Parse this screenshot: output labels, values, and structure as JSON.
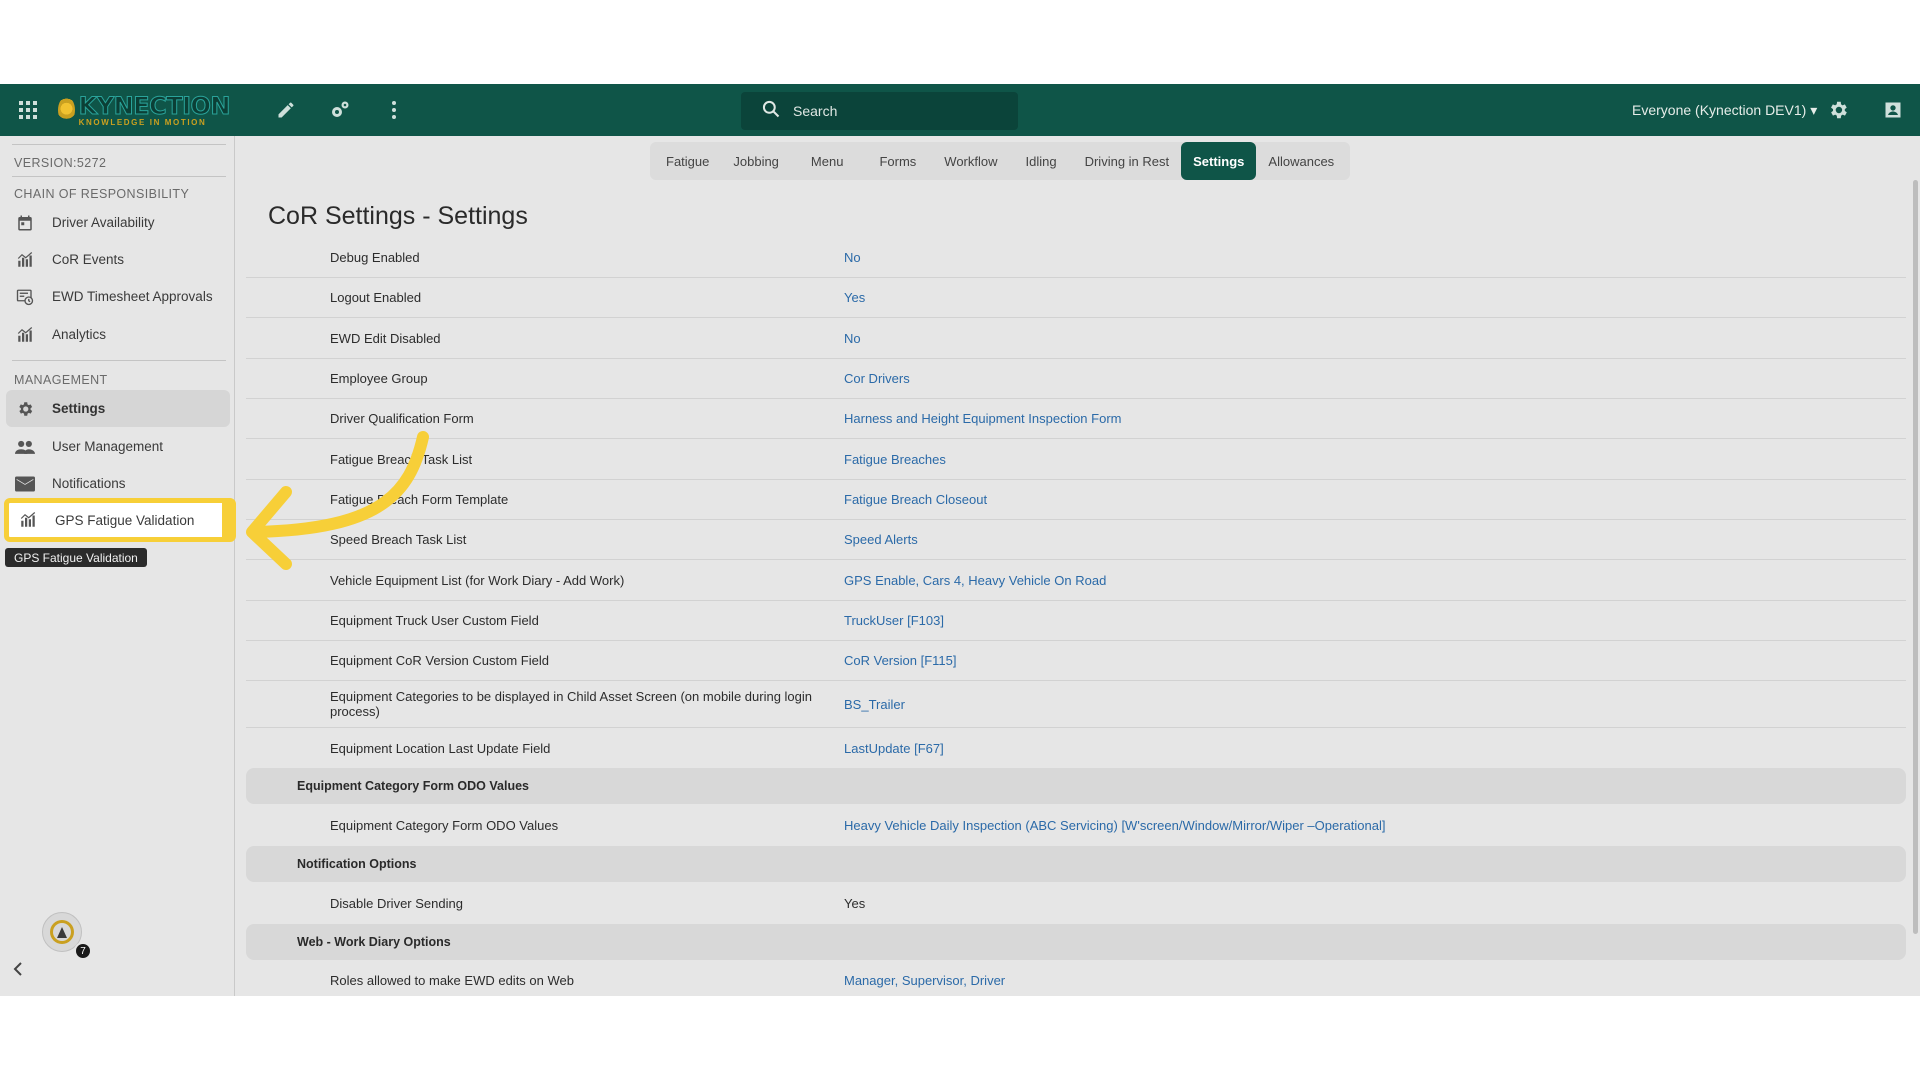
{
  "topbar": {
    "search_placeholder": "Search",
    "user_label": "Everyone (Kynection DEV1) ▾",
    "logo_title": "KYNECTION",
    "logo_tagline": "KNOWLEDGE IN MOTION"
  },
  "sidebar": {
    "version": "VERSION:5272",
    "sections": [
      {
        "heading": "CHAIN OF RESPONSIBILITY",
        "items": [
          {
            "label": "Driver Availability",
            "icon": "calendar-icon"
          },
          {
            "label": "CoR Events",
            "icon": "chart-icon"
          },
          {
            "label": "EWD Timesheet Approvals",
            "icon": "timesheet-icon"
          },
          {
            "label": "Analytics",
            "icon": "chart-icon"
          }
        ]
      },
      {
        "heading": "MANAGEMENT",
        "items": [
          {
            "label": "Settings",
            "icon": "gear-icon",
            "active": true
          },
          {
            "label": "User Management",
            "icon": "users-icon"
          },
          {
            "label": "Notifications",
            "icon": "mail-icon"
          },
          {
            "label": "GPS Fatigue Validation",
            "icon": "chart-icon",
            "highlighted": true
          }
        ]
      }
    ],
    "tooltip": "GPS Fatigue Validation",
    "avatar_badge": "7"
  },
  "tabs": [
    {
      "label": "Fatigue"
    },
    {
      "label": "Jobbing"
    },
    {
      "label": "Menu"
    },
    {
      "label": "Forms"
    },
    {
      "label": "Workflow"
    },
    {
      "label": "Idling"
    },
    {
      "label": "Driving in Rest"
    },
    {
      "label": "Settings",
      "active": true
    },
    {
      "label": "Allowances"
    }
  ],
  "page_title": "CoR Settings - Settings",
  "settings": [
    {
      "type": "row",
      "label": "Debug Enabled",
      "value": "No"
    },
    {
      "type": "row",
      "label": "Logout Enabled",
      "value": "Yes"
    },
    {
      "type": "row",
      "label": "EWD Edit Disabled",
      "value": "No"
    },
    {
      "type": "row",
      "label": "Employee Group",
      "value": "Cor Drivers"
    },
    {
      "type": "row",
      "label": "Driver Qualification Form",
      "value": "Harness and Height Equipment Inspection Form"
    },
    {
      "type": "row",
      "label": "Fatigue Breach Task List",
      "value": "Fatigue Breaches"
    },
    {
      "type": "row",
      "label": "Fatigue Breach Form Template",
      "value": "Fatigue Breach Closeout"
    },
    {
      "type": "row",
      "label": "Speed Breach Task List",
      "value": "Speed Alerts"
    },
    {
      "type": "row",
      "label": "Vehicle Equipment List (for Work Diary - Add Work)",
      "value": "GPS Enable, Cars 4, Heavy Vehicle On Road"
    },
    {
      "type": "row",
      "label": "Equipment Truck User Custom Field",
      "value": "TruckUser [F103]"
    },
    {
      "type": "row",
      "label": "Equipment CoR Version Custom Field",
      "value": "CoR Version [F115]"
    },
    {
      "type": "row",
      "label": "Equipment Categories to be displayed in Child Asset Screen (on mobile during login process)",
      "value": "BS_Trailer",
      "tall": true
    },
    {
      "type": "row",
      "label": "Equipment Location Last Update Field",
      "value": "LastUpdate [F67]"
    },
    {
      "type": "group",
      "label": "Equipment Category Form ODO Values"
    },
    {
      "type": "row",
      "label": "Equipment Category Form ODO Values",
      "value": "Heavy Vehicle Daily Inspection (ABC Servicing) [W'screen/Window/Mirror/Wiper –Operational]"
    },
    {
      "type": "group",
      "label": "Notification Options"
    },
    {
      "type": "row",
      "label": "Disable Driver Sending",
      "value": "Yes",
      "plain": true
    },
    {
      "type": "group",
      "label": "Web - Work Diary Options"
    },
    {
      "type": "row",
      "label": "Roles allowed to make EWD edits on Web",
      "value": "Manager, Supervisor, Driver"
    }
  ],
  "colors": {
    "brand": "#0f5548",
    "link": "#2b6aa8",
    "callout": "#f7cf38"
  }
}
